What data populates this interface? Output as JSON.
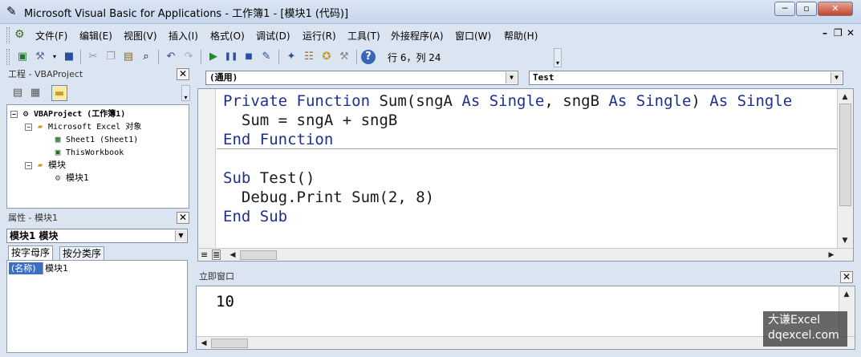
{
  "window": {
    "title": "Microsoft Visual Basic for Applications - 工作簿1 - [模块1 (代码)]",
    "minimize": "─",
    "restore": "▫",
    "close": "✕"
  },
  "menu": {
    "items": [
      "文件(F)",
      "编辑(E)",
      "视图(V)",
      "插入(I)",
      "格式(O)",
      "调试(D)",
      "运行(R)",
      "工具(T)",
      "外接程序(A)",
      "窗口(W)",
      "帮助(H)"
    ],
    "mdi_minimize": "–",
    "mdi_restore": "❐",
    "mdi_close": "✕"
  },
  "toolbar": {
    "position": "行 6，列 24"
  },
  "project": {
    "title": "工程 - VBAProject",
    "tree": [
      {
        "label": "VBAProject (工作簿1)",
        "bold": true
      },
      {
        "label": "Microsoft Excel 对象"
      },
      {
        "label": "Sheet1 (Sheet1)"
      },
      {
        "label": "ThisWorkbook"
      },
      {
        "label": "模块"
      },
      {
        "label": "模块1"
      }
    ]
  },
  "properties": {
    "title": "属性 - 模块1",
    "object_selector": "模块1 模块",
    "tabs": [
      "按字母序",
      "按分类序"
    ],
    "rows": [
      {
        "name": "(名称)",
        "value": "模块1"
      }
    ]
  },
  "editor": {
    "object_combo": "(通用)",
    "procedure_combo": "Test",
    "lines": [
      [
        {
          "t": "Private Function ",
          "k": true
        },
        {
          "t": "Sum(sngA ",
          "k": false
        },
        {
          "t": "As Single",
          "k": true
        },
        {
          "t": ", sngB ",
          "k": false
        },
        {
          "t": "As Single",
          "k": true
        },
        {
          "t": ") ",
          "k": false
        },
        {
          "t": "As Single",
          "k": true
        }
      ],
      [
        {
          "t": "  Sum = sngA + sngB",
          "k": false
        }
      ],
      [
        {
          "t": "End Function",
          "k": true
        }
      ],
      [
        {
          "t": "",
          "k": false
        }
      ],
      [
        {
          "t": "Sub ",
          "k": true
        },
        {
          "t": "Test()",
          "k": false
        }
      ],
      [
        {
          "t": "  Debug.Print Sum(2, 8)",
          "k": false
        }
      ],
      [
        {
          "t": "End Sub",
          "k": true
        }
      ]
    ]
  },
  "immediate": {
    "title": "立即窗口",
    "output": "10"
  },
  "watermark": {
    "line1": "大谦Excel",
    "line2": "dqexcel.com"
  },
  "colors": {
    "keyword": "#1f2f8f",
    "chrome": "#dbe4f1",
    "selection": "#3a6fc4"
  }
}
